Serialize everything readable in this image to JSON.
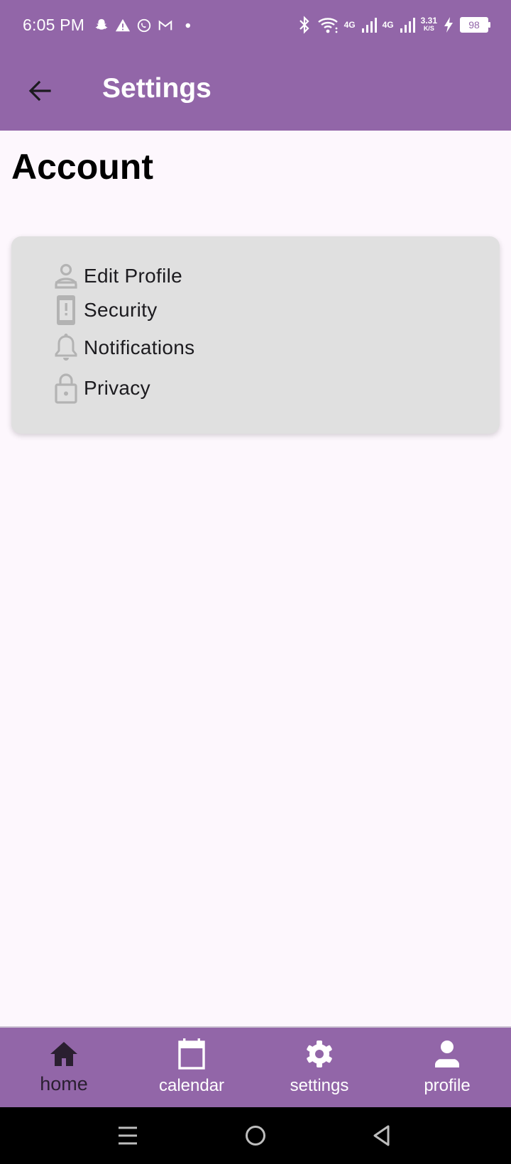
{
  "status_bar": {
    "time": "6:05 PM",
    "network_1": "4G",
    "network_2": "4G",
    "speed_value": "3.31",
    "speed_unit": "K/S",
    "battery": "98"
  },
  "app_bar": {
    "title": "Settings",
    "back_icon": "arrow-back-icon"
  },
  "section": {
    "heading": "Account"
  },
  "settings_items": [
    {
      "label": "Edit Profile",
      "icon": "person-icon"
    },
    {
      "label": "Security",
      "icon": "phone-alert-icon"
    },
    {
      "label": "Notifications",
      "icon": "bell-icon"
    },
    {
      "label": "Privacy",
      "icon": "lock-icon"
    }
  ],
  "bottom_nav": {
    "items": [
      {
        "label": "home",
        "icon": "home-icon",
        "active": true
      },
      {
        "label": "calendar",
        "icon": "calendar-icon"
      },
      {
        "label": "settings",
        "icon": "gear-icon"
      },
      {
        "label": "profile",
        "icon": "person-icon"
      }
    ]
  },
  "colors": {
    "primary": "#9266a8",
    "background": "#fdf7fd",
    "card": "#e0e0e0",
    "icon_gray": "#b3b3b3"
  }
}
